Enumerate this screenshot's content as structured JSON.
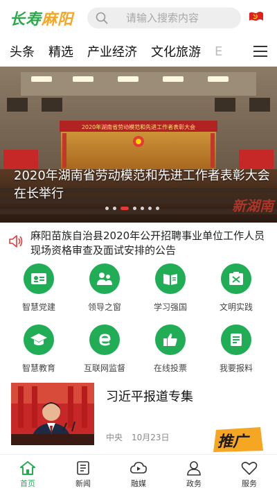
{
  "header": {
    "logo_main": "长寿",
    "logo_accent": "麻阳",
    "search_placeholder": "请输入搜索内容",
    "flag_icon": "party-flag-icon"
  },
  "nav": {
    "tabs": [
      "头条",
      "精选",
      "产业经济",
      "文化旅游",
      "E"
    ],
    "menu_icon": "hamburger-menu-icon"
  },
  "banner": {
    "title": "2020年湖南省劳动模范和先进工作者表彰大会在长举行",
    "stage_banner_text": "2020年湖南省劳动模范和先进工作者表彰大会",
    "watermark": "新湖南",
    "slide_count": 7,
    "active_slide": 3
  },
  "notice": {
    "icon": "speaker-icon",
    "text": "麻阳苗族自治县2020年公开招聘事业单位工作人员现场资格审查及面试安排的公告"
  },
  "grid": {
    "items": [
      {
        "label": "智慧党建",
        "icon": "id-card-icon"
      },
      {
        "label": "领导之窗",
        "icon": "leaders-icon"
      },
      {
        "label": "学习强国",
        "icon": "book-icon"
      },
      {
        "label": "文明实践",
        "icon": "stamp-icon"
      },
      {
        "label": "智慧教育",
        "icon": "graduation-cap-icon"
      },
      {
        "label": "互联网监督",
        "icon": "internet-e-icon"
      },
      {
        "label": "在线投票",
        "icon": "thumbs-up-icon"
      },
      {
        "label": "我要报料",
        "icon": "report-doc-icon"
      }
    ]
  },
  "news": {
    "title": "习近平报道专集",
    "source": "中央",
    "date": "10月23日",
    "promo_text": "推广"
  },
  "bottom_nav": {
    "items": [
      {
        "label": "首页",
        "icon": "home-icon",
        "active": true
      },
      {
        "label": "新闻",
        "icon": "news-icon",
        "active": false
      },
      {
        "label": "融媒",
        "icon": "cloud-play-icon",
        "active": false
      },
      {
        "label": "政务",
        "icon": "user-gov-icon",
        "active": false
      },
      {
        "label": "服务",
        "icon": "heart-service-icon",
        "active": false
      }
    ]
  },
  "colors": {
    "brand_green": "#21ad56",
    "accent_orange": "#f5a623",
    "alert_red": "#e53935"
  }
}
